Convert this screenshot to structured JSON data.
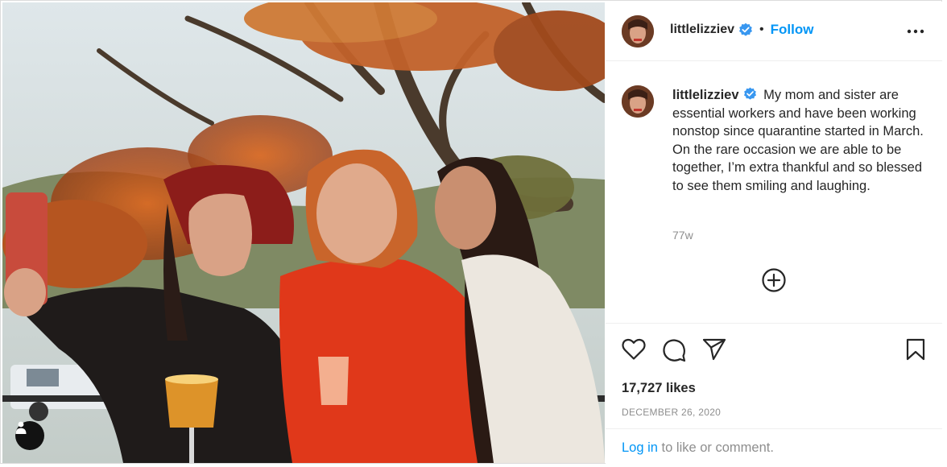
{
  "post": {
    "username": "littlelizziev",
    "follow_label": "Follow",
    "separator": "•",
    "caption": "My mom and sister are essential workers and have been working nonstop since quarantine started in March. On the rare occasion we are able to be together, I’m extra thankful and so blessed to see them smiling and laughing.",
    "time_ago": "77w",
    "likes": "17,727 likes",
    "date": "DECEMBER 26, 2020",
    "login_link": "Log in",
    "login_suffix": " to like or comment."
  },
  "icons": {
    "verified": "verified-badge-icon",
    "more": "more-options-icon",
    "add_comment": "add-circle-icon",
    "like": "heart-icon",
    "comment": "comment-icon",
    "share": "share-icon",
    "save": "bookmark-icon",
    "user_tag": "user-tag-icon"
  },
  "colors": {
    "accent": "#0095f6",
    "verified": "#3897f0",
    "muted": "#8e8e8e",
    "text": "#262626"
  }
}
